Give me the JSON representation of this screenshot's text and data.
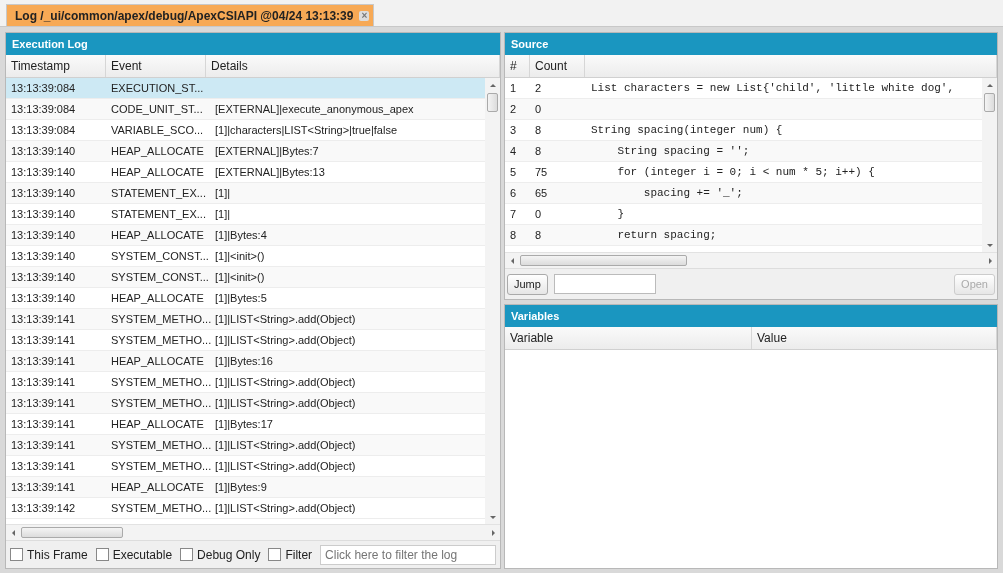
{
  "tab": {
    "label": "Log /_ui/common/apex/debug/ApexCSIAPI @04/24 13:13:39",
    "selected": true,
    "close": "×"
  },
  "execution_log": {
    "title": "Execution Log",
    "columns": [
      "Timestamp",
      "Event",
      "Details"
    ],
    "rows": [
      {
        "timestamp": "13:13:39:084",
        "event": "EXECUTION_ST...",
        "selected": true
      },
      {
        "timestamp": "13:13:39:084",
        "event": "CODE_UNIT_ST...",
        "details": "[EXTERNAL]|execute_anonymous_apex",
        "selected": false
      },
      {
        "timestamp": "13:13:39:084",
        "event": "VARIABLE_SCO...",
        "details": "[1]|characters|LIST<String>|true|false",
        "selected": false
      },
      {
        "timestamp": "13:13:39:140",
        "event": "HEAP_ALLOCATE",
        "details": "[EXTERNAL]|Bytes:7",
        "selected": false
      },
      {
        "timestamp": "13:13:39:140",
        "event": "HEAP_ALLOCATE",
        "details": "[EXTERNAL]|Bytes:13",
        "selected": false
      },
      {
        "timestamp": "13:13:39:140",
        "event": "STATEMENT_EX...",
        "details": "[1]|",
        "selected": false
      },
      {
        "timestamp": "13:13:39:140",
        "event": "STATEMENT_EX...",
        "details": "[1]|",
        "selected": false
      },
      {
        "timestamp": "13:13:39:140",
        "event": "HEAP_ALLOCATE",
        "details": "[1]|Bytes:4",
        "selected": false
      },
      {
        "timestamp": "13:13:39:140",
        "event": "SYSTEM_CONST...",
        "details": "[1]|<init>()",
        "selected": false
      },
      {
        "timestamp": "13:13:39:140",
        "event": "SYSTEM_CONST...",
        "details": "[1]|<init>()",
        "selected": false
      },
      {
        "timestamp": "13:13:39:140",
        "event": "HEAP_ALLOCATE",
        "details": "[1]|Bytes:5",
        "selected": false
      },
      {
        "timestamp": "13:13:39:141",
        "event": "SYSTEM_METHO...",
        "details": "[1]|LIST<String>.add(Object)",
        "selected": false
      },
      {
        "timestamp": "13:13:39:141",
        "event": "SYSTEM_METHO...",
        "details": "[1]|LIST<String>.add(Object)",
        "selected": false
      },
      {
        "timestamp": "13:13:39:141",
        "event": "HEAP_ALLOCATE",
        "details": "[1]|Bytes:16",
        "selected": false
      },
      {
        "timestamp": "13:13:39:141",
        "event": "SYSTEM_METHO...",
        "details": "[1]|LIST<String>.add(Object)",
        "selected": false
      },
      {
        "timestamp": "13:13:39:141",
        "event": "SYSTEM_METHO...",
        "details": "[1]|LIST<String>.add(Object)",
        "selected": false
      },
      {
        "timestamp": "13:13:39:141",
        "event": "HEAP_ALLOCATE",
        "details": "[1]|Bytes:17",
        "selected": false
      },
      {
        "timestamp": "13:13:39:141",
        "event": "SYSTEM_METHO...",
        "details": "[1]|LIST<String>.add(Object)",
        "selected": false
      },
      {
        "timestamp": "13:13:39:141",
        "event": "SYSTEM_METHO...",
        "details": "[1]|LIST<String>.add(Object)",
        "selected": false
      },
      {
        "timestamp": "13:13:39:141",
        "event": "HEAP_ALLOCATE",
        "details": "[1]|Bytes:9",
        "selected": false
      },
      {
        "timestamp": "13:13:39:142",
        "event": "SYSTEM_METHO...",
        "details": "[1]|LIST<String>.add(Object)",
        "selected": false
      }
    ],
    "filters": [
      {
        "label": "This Frame",
        "checked": false
      },
      {
        "label": "Executable",
        "checked": false
      },
      {
        "label": "Debug Only",
        "checked": false
      },
      {
        "label": "Filter",
        "checked": false
      }
    ],
    "filter_field": {
      "placeholder": "Click here to filter the log"
    }
  },
  "source": {
    "title": "Source",
    "columns": [
      "#",
      "Count"
    ],
    "lines": [
      {
        "number": "1",
        "count": "2",
        "code": "List characters = new List{'child', 'little white dog',"
      },
      {
        "number": "2",
        "count": "0"
      },
      {
        "number": "3",
        "count": "8",
        "code": "String spacing(integer num) {"
      },
      {
        "number": "4",
        "count": "8",
        "code": "    String spacing = '';"
      },
      {
        "number": "5",
        "count": "75",
        "code": "    for (integer i = 0; i < num * 5; i++) {"
      },
      {
        "number": "6",
        "count": "65",
        "code": "        spacing += '_';"
      },
      {
        "number": "7",
        "count": "0",
        "code": "    }"
      },
      {
        "number": "8",
        "count": "8",
        "code": "    return spacing;"
      }
    ],
    "jump_button": "Jump",
    "open_button": {
      "label": "Open",
      "disabled": true
    }
  },
  "variables": {
    "title": "Variables",
    "columns": [
      "Variable",
      "Value"
    ]
  }
}
